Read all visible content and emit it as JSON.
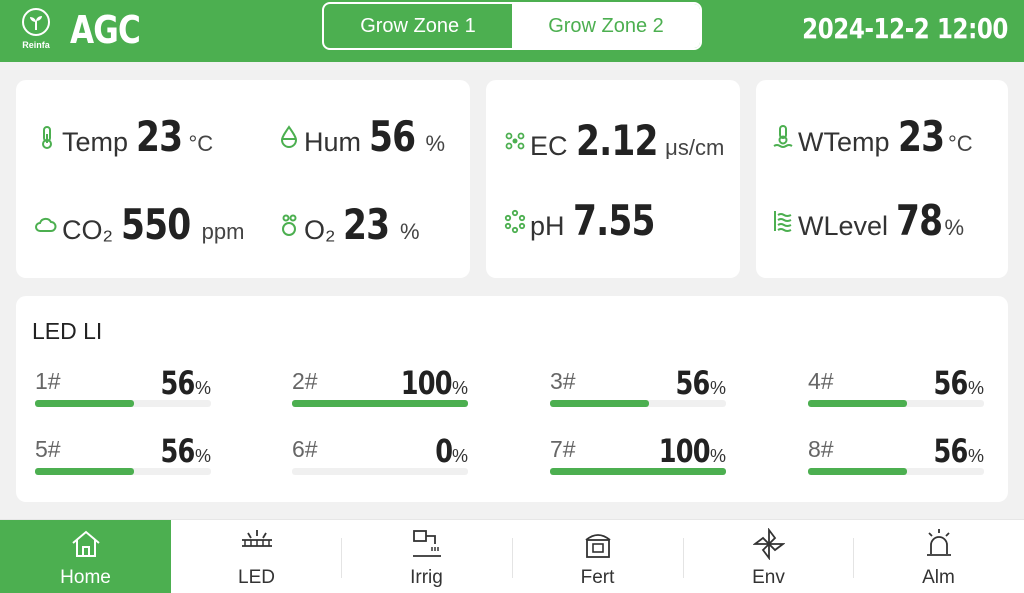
{
  "header": {
    "brand": "Reinfa",
    "title": "AGC",
    "zones": [
      "Grow Zone 1",
      "Grow Zone 2"
    ],
    "active_zone": "Grow Zone 2",
    "datetime": "2024-12-2  12:00"
  },
  "sensors": {
    "temp": {
      "label": "Temp",
      "value": "23",
      "unit": "°C"
    },
    "hum": {
      "label": "Hum",
      "value": "56",
      "unit": "%"
    },
    "co2": {
      "label": "CO₂",
      "value": "550",
      "unit": "ppm"
    },
    "o2": {
      "label": "O₂",
      "value": "23",
      "unit": "%"
    },
    "ec": {
      "label": "EC",
      "value": "2.12",
      "unit": "μs/cm"
    },
    "ph": {
      "label": "pH",
      "value": "7.55"
    },
    "wtemp": {
      "label": "WTemp",
      "value": "23",
      "unit": "°C"
    },
    "wlevel": {
      "label": "WLevel",
      "value": "78",
      "unit": "%"
    }
  },
  "led_li": {
    "title": "LED LI",
    "percent_sign": "%",
    "items": [
      {
        "label": "1#",
        "value": "56",
        "fraction": 0.56
      },
      {
        "label": "2#",
        "value": "100",
        "fraction": 1.0
      },
      {
        "label": "3#",
        "value": "56",
        "fraction": 0.56
      },
      {
        "label": "4#",
        "value": "56",
        "fraction": 0.56
      },
      {
        "label": "5#",
        "value": "56",
        "fraction": 0.56
      },
      {
        "label": "6#",
        "value": "0",
        "fraction": 0.0
      },
      {
        "label": "7#",
        "value": "100",
        "fraction": 1.0
      },
      {
        "label": "8#",
        "value": "56",
        "fraction": 0.56
      }
    ]
  },
  "nav": {
    "items": [
      "Home",
      "LED",
      "Irrig",
      "Fert",
      "Env",
      "Alm"
    ],
    "active": "Home"
  },
  "colors": {
    "accent": "#4caf50",
    "background": "#f1f1f1",
    "card": "#ffffff",
    "bar_track": "#f0f0f0"
  }
}
